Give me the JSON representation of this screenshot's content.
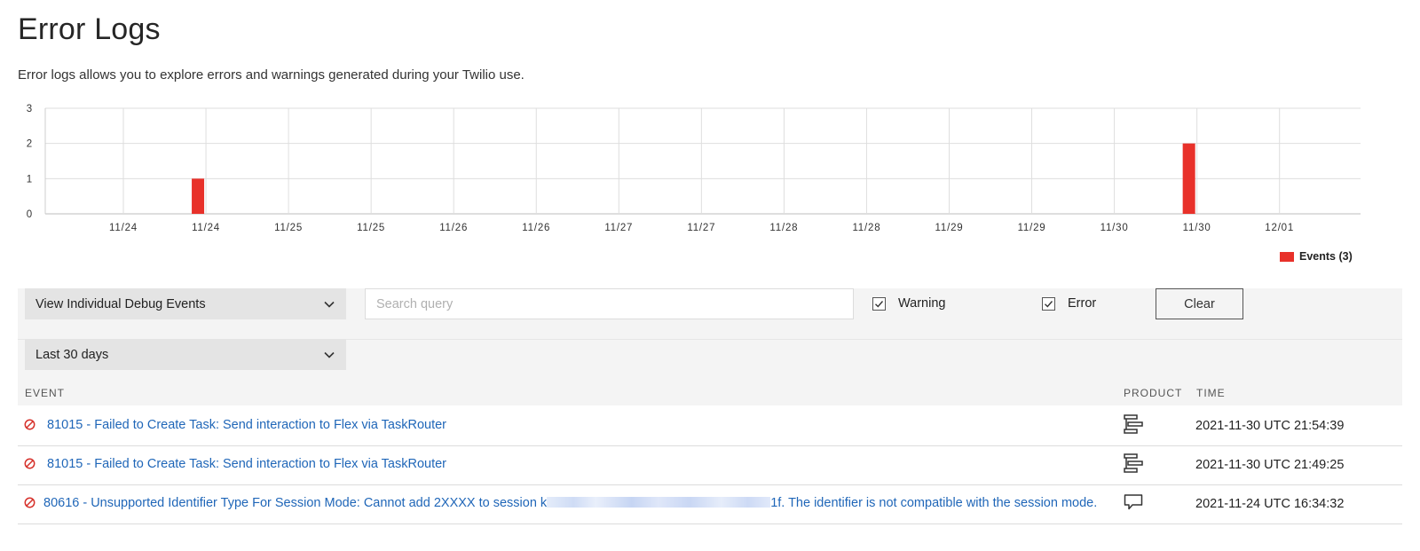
{
  "page": {
    "title": "Error Logs",
    "subtitle": "Error logs allows you to explore errors and warnings generated during your Twilio use."
  },
  "colors": {
    "bar": "#e8312a",
    "link": "#1f66b8",
    "error_icon": "#d6312b"
  },
  "chart_data": {
    "type": "bar",
    "categories": [
      "11/24",
      "11/24",
      "11/25",
      "11/25",
      "11/26",
      "11/26",
      "11/27",
      "11/27",
      "11/28",
      "11/28",
      "11/29",
      "11/29",
      "11/30",
      "11/30",
      "12/01"
    ],
    "series": [
      {
        "name": "Events (3)",
        "values": [
          0,
          1,
          0,
          0,
          0,
          0,
          0,
          0,
          0,
          0,
          0,
          0,
          0,
          2,
          0
        ]
      }
    ],
    "ylim": [
      0,
      3
    ],
    "yticks": [
      0,
      1,
      2,
      3
    ],
    "grid": true,
    "legend": "bottom-right"
  },
  "filters": {
    "view_select": "View Individual Debug Events",
    "search_placeholder": "Search query",
    "warning_label": "Warning",
    "warning_checked": true,
    "error_label": "Error",
    "error_checked": true,
    "clear_label": "Clear",
    "range_select": "Last 30 days"
  },
  "table": {
    "columns": {
      "event": "EVENT",
      "product": "PRODUCT",
      "time": "TIME"
    },
    "rows": [
      {
        "event": "81015 - Failed to Create Task: Send interaction to Flex via TaskRouter",
        "product_icon": "taskrouter-icon",
        "time": "2021-11-30 UTC 21:54:39"
      },
      {
        "event": "81015 - Failed to Create Task: Send interaction to Flex via TaskRouter",
        "product_icon": "taskrouter-icon",
        "time": "2021-11-30 UTC 21:49:25"
      },
      {
        "event_prefix": "80616 - Unsupported Identifier Type For Session Mode: Cannot add 2XXXX to session k",
        "event_suffix": "1f. The identifier is not compatible with the session mode.",
        "product_icon": "chat-bubble-icon",
        "time": "2021-11-24 UTC 16:34:32"
      }
    ]
  }
}
